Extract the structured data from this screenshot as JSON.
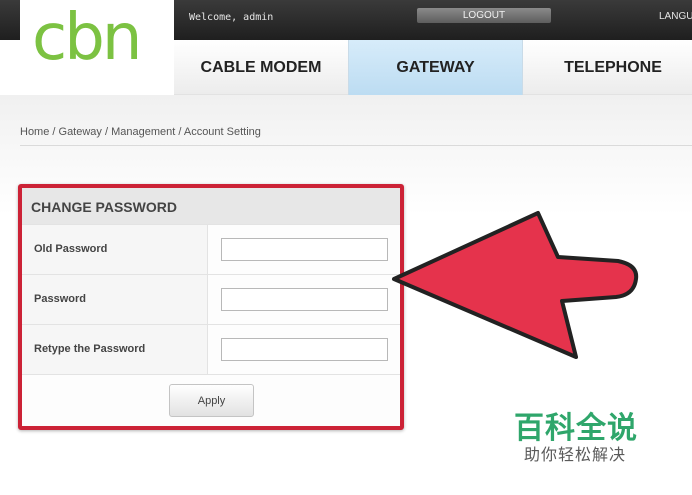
{
  "topbar": {
    "welcome": "Welcome, admin",
    "logout_label": "LOGOUT",
    "language_label": "LANGU"
  },
  "brand": {
    "logo_text": "cbn",
    "color": "#7cc242"
  },
  "nav": {
    "items": [
      {
        "label": "CABLE MODEM"
      },
      {
        "label": "GATEWAY",
        "active": true
      },
      {
        "label": "TELEPHONE"
      }
    ]
  },
  "breadcrumb": "Home / Gateway / Management / Account Setting",
  "change_password": {
    "title": "CHANGE PASSWORD",
    "fields": [
      {
        "label": "Old Password",
        "value": ""
      },
      {
        "label": "Password",
        "value": ""
      },
      {
        "label": "Retype the Password",
        "value": ""
      }
    ],
    "apply_label": "Apply"
  },
  "annotation": {
    "highlight_color": "#cc2236",
    "arrow_color": "#e5334c"
  },
  "watermark": {
    "title": "百科全说",
    "subtitle": "助你轻松解决",
    "color": "#2fa66b"
  }
}
